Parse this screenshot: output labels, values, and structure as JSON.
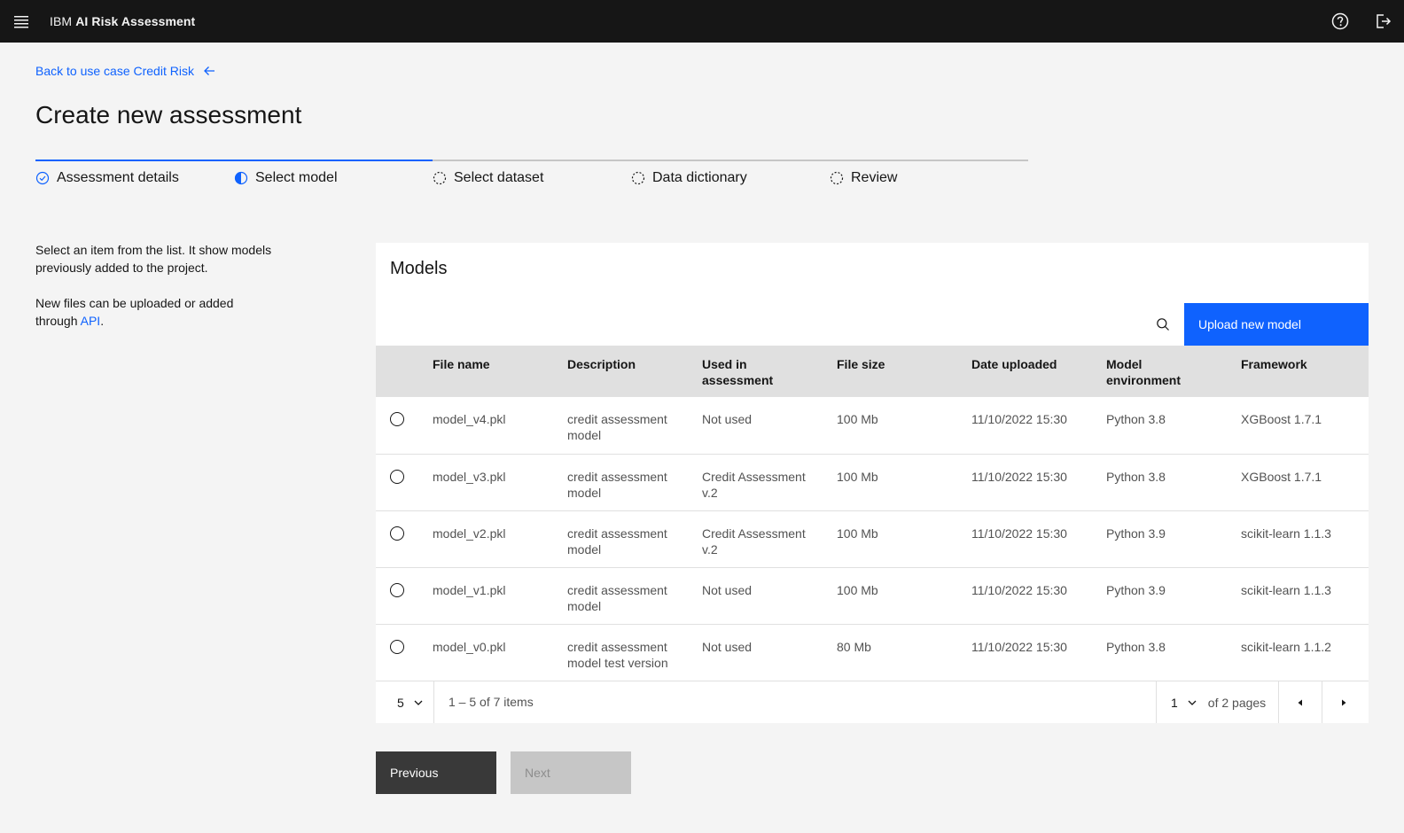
{
  "header": {
    "brand_prefix": "IBM",
    "brand_name": "AI Risk Assessment",
    "icons": [
      "menu-icon",
      "help-icon",
      "logout-icon"
    ]
  },
  "back_link": {
    "label": "Back to use case Credit Risk",
    "icon": "arrow-left-icon"
  },
  "page_title": "Create new assessment",
  "steps": [
    {
      "label": "Assessment details",
      "state": "complete"
    },
    {
      "label": "Select model",
      "state": "current"
    },
    {
      "label": "Select dataset",
      "state": "incomplete"
    },
    {
      "label": "Data dictionary",
      "state": "incomplete"
    },
    {
      "label": "Review",
      "state": "incomplete"
    }
  ],
  "help": {
    "line1": "Select an item from the list. It show models previously added to the project.",
    "line2_prefix": "New files can be uploaded or added through ",
    "line2_link": "API",
    "line2_suffix": "."
  },
  "models": {
    "title": "Models",
    "upload_label": "Upload new model",
    "columns": [
      "File name",
      "Description",
      "Used in assessment",
      "File size",
      "Date uploaded",
      "Model environment",
      "Framework"
    ],
    "rows": [
      {
        "file": "model_v4.pkl",
        "desc": "credit assessment model",
        "used": "Not used",
        "size": "100 Mb",
        "date": "11/10/2022 15:30",
        "env": "Python 3.8",
        "framework": "XGBoost 1.7.1"
      },
      {
        "file": "model_v3.pkl",
        "desc": "credit assessment model",
        "used": "Credit Assessment v.2",
        "size": "100 Mb",
        "date": "11/10/2022 15:30",
        "env": "Python 3.8",
        "framework": "XGBoost 1.7.1"
      },
      {
        "file": "model_v2.pkl",
        "desc": "credit assessment model",
        "used": "Credit Assessment v.2",
        "size": "100 Mb",
        "date": "11/10/2022 15:30",
        "env": "Python 3.9",
        "framework": "scikit-learn 1.1.3"
      },
      {
        "file": "model_v1.pkl",
        "desc": "credit assessment model",
        "used": "Not used",
        "size": "100 Mb",
        "date": "11/10/2022 15:30",
        "env": "Python 3.9",
        "framework": "scikit-learn 1.1.3"
      },
      {
        "file": "model_v0.pkl",
        "desc": "credit assessment model test version",
        "used": "Not used",
        "size": "80 Mb",
        "date": "11/10/2022 15:30",
        "env": "Python 3.8",
        "framework": "scikit-learn 1.1.2"
      }
    ]
  },
  "pagination": {
    "page_size": "5",
    "range_text": "1 – 5 of 7 items",
    "current_page": "1",
    "of_pages": "of 2 pages"
  },
  "buttons": {
    "previous": "Previous",
    "next": "Next"
  },
  "colors": {
    "primary": "#0f62fe",
    "header_bg": "#161616",
    "page_bg": "#f4f4f4"
  }
}
